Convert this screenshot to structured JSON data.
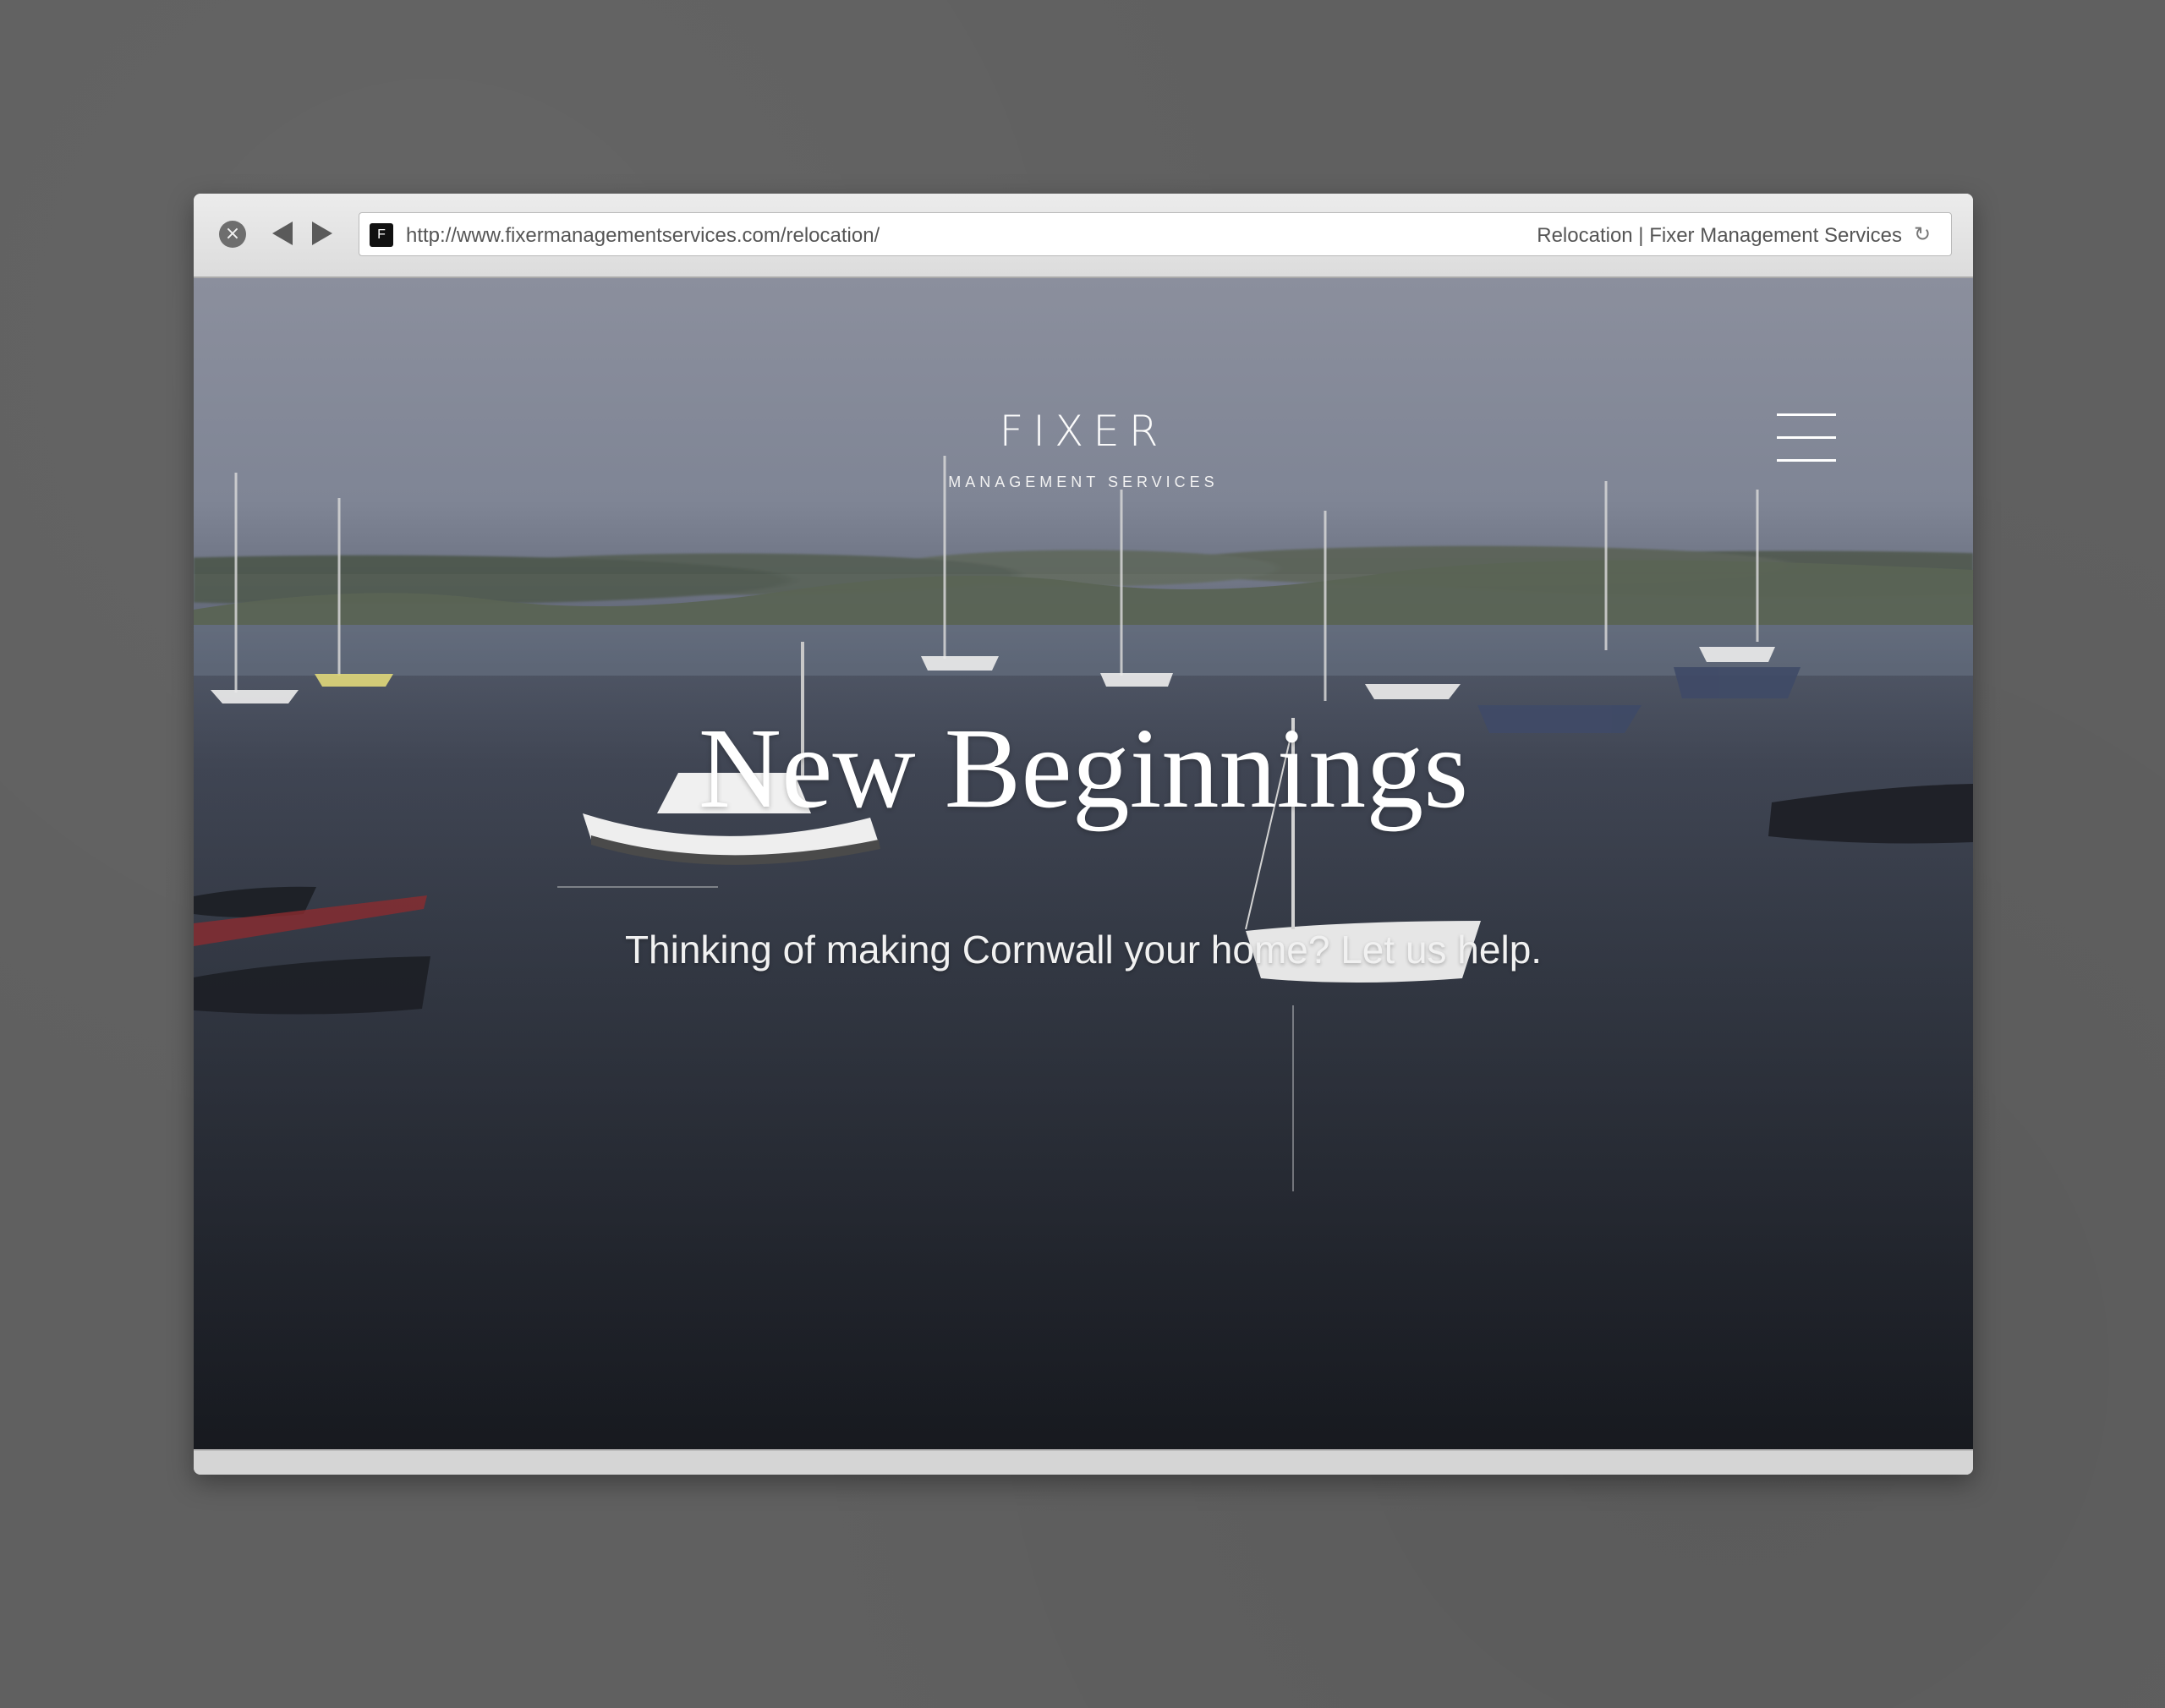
{
  "browser": {
    "url": "http://www.fixermanagementservices.com/relocation/",
    "title": "Relocation | Fixer Management Services",
    "favicon": "F"
  },
  "site": {
    "logo": "FIXER",
    "logo_subtitle": "MANAGEMENT SERVICES",
    "menu_icon": "hamburger-icon"
  },
  "hero": {
    "title": "New Beginnings",
    "subtitle": "Thinking of making Cornwall your home? Let us help."
  },
  "colors": {
    "background": "#606060",
    "window": "#d6d6d6",
    "text_light": "#ffffff"
  }
}
